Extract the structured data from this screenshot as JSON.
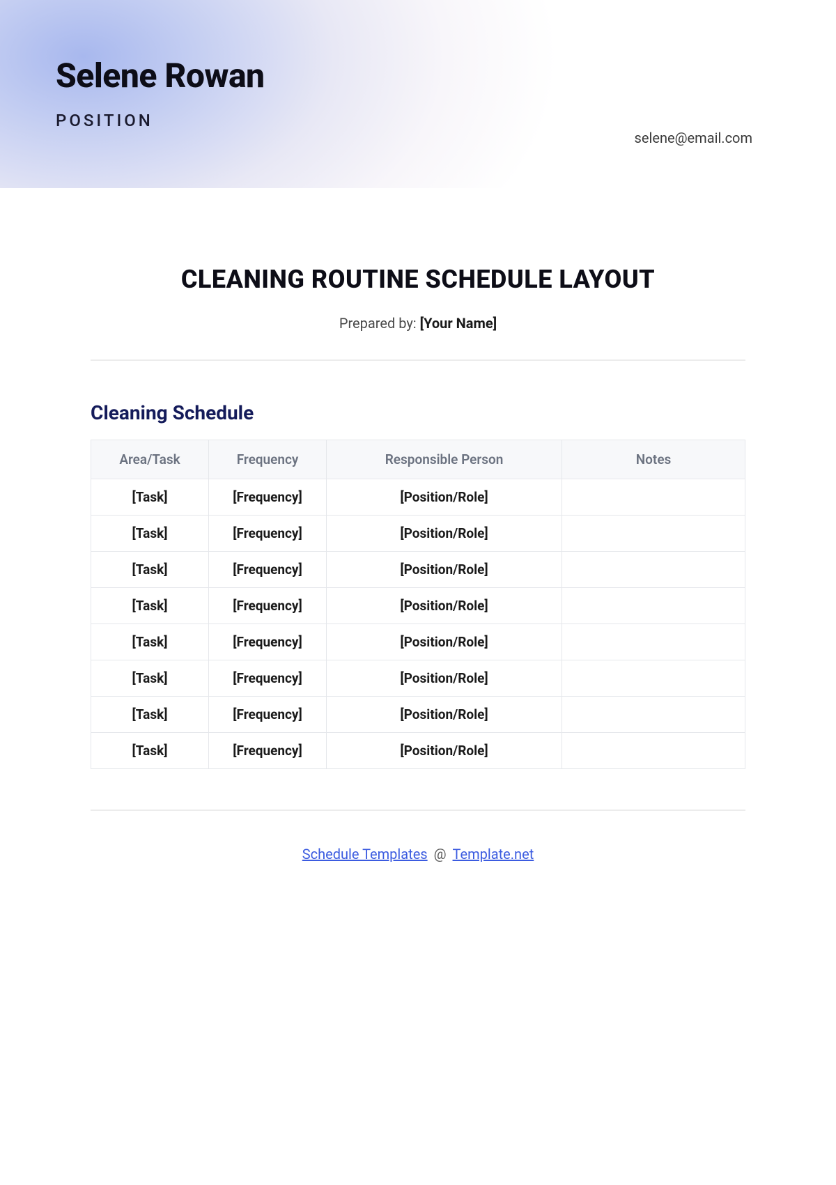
{
  "banner": {
    "author_name": "Selene Rowan",
    "author_position": "POSITION",
    "author_email": "selene@email.com"
  },
  "document": {
    "title": "CLEANING ROUTINE SCHEDULE LAYOUT",
    "prepared_by_label": "Prepared by: ",
    "prepared_by_value": "[Your Name]"
  },
  "section": {
    "title": "Cleaning Schedule"
  },
  "table": {
    "headers": {
      "area_task": "Area/Task",
      "frequency": "Frequency",
      "responsible": "Responsible Person",
      "notes": "Notes"
    },
    "rows": [
      {
        "task": "[Task]",
        "frequency": "[Frequency]",
        "responsible": "[Position/Role]",
        "notes": ""
      },
      {
        "task": "[Task]",
        "frequency": "[Frequency]",
        "responsible": "[Position/Role]",
        "notes": ""
      },
      {
        "task": "[Task]",
        "frequency": "[Frequency]",
        "responsible": "[Position/Role]",
        "notes": ""
      },
      {
        "task": "[Task]",
        "frequency": "[Frequency]",
        "responsible": "[Position/Role]",
        "notes": ""
      },
      {
        "task": "[Task]",
        "frequency": "[Frequency]",
        "responsible": "[Position/Role]",
        "notes": ""
      },
      {
        "task": "[Task]",
        "frequency": "[Frequency]",
        "responsible": "[Position/Role]",
        "notes": ""
      },
      {
        "task": "[Task]",
        "frequency": "[Frequency]",
        "responsible": "[Position/Role]",
        "notes": ""
      },
      {
        "task": "[Task]",
        "frequency": "[Frequency]",
        "responsible": "[Position/Role]",
        "notes": ""
      }
    ]
  },
  "footer": {
    "link1_text": "Schedule Templates",
    "separator": " @ ",
    "link2_text": "Template.net"
  }
}
